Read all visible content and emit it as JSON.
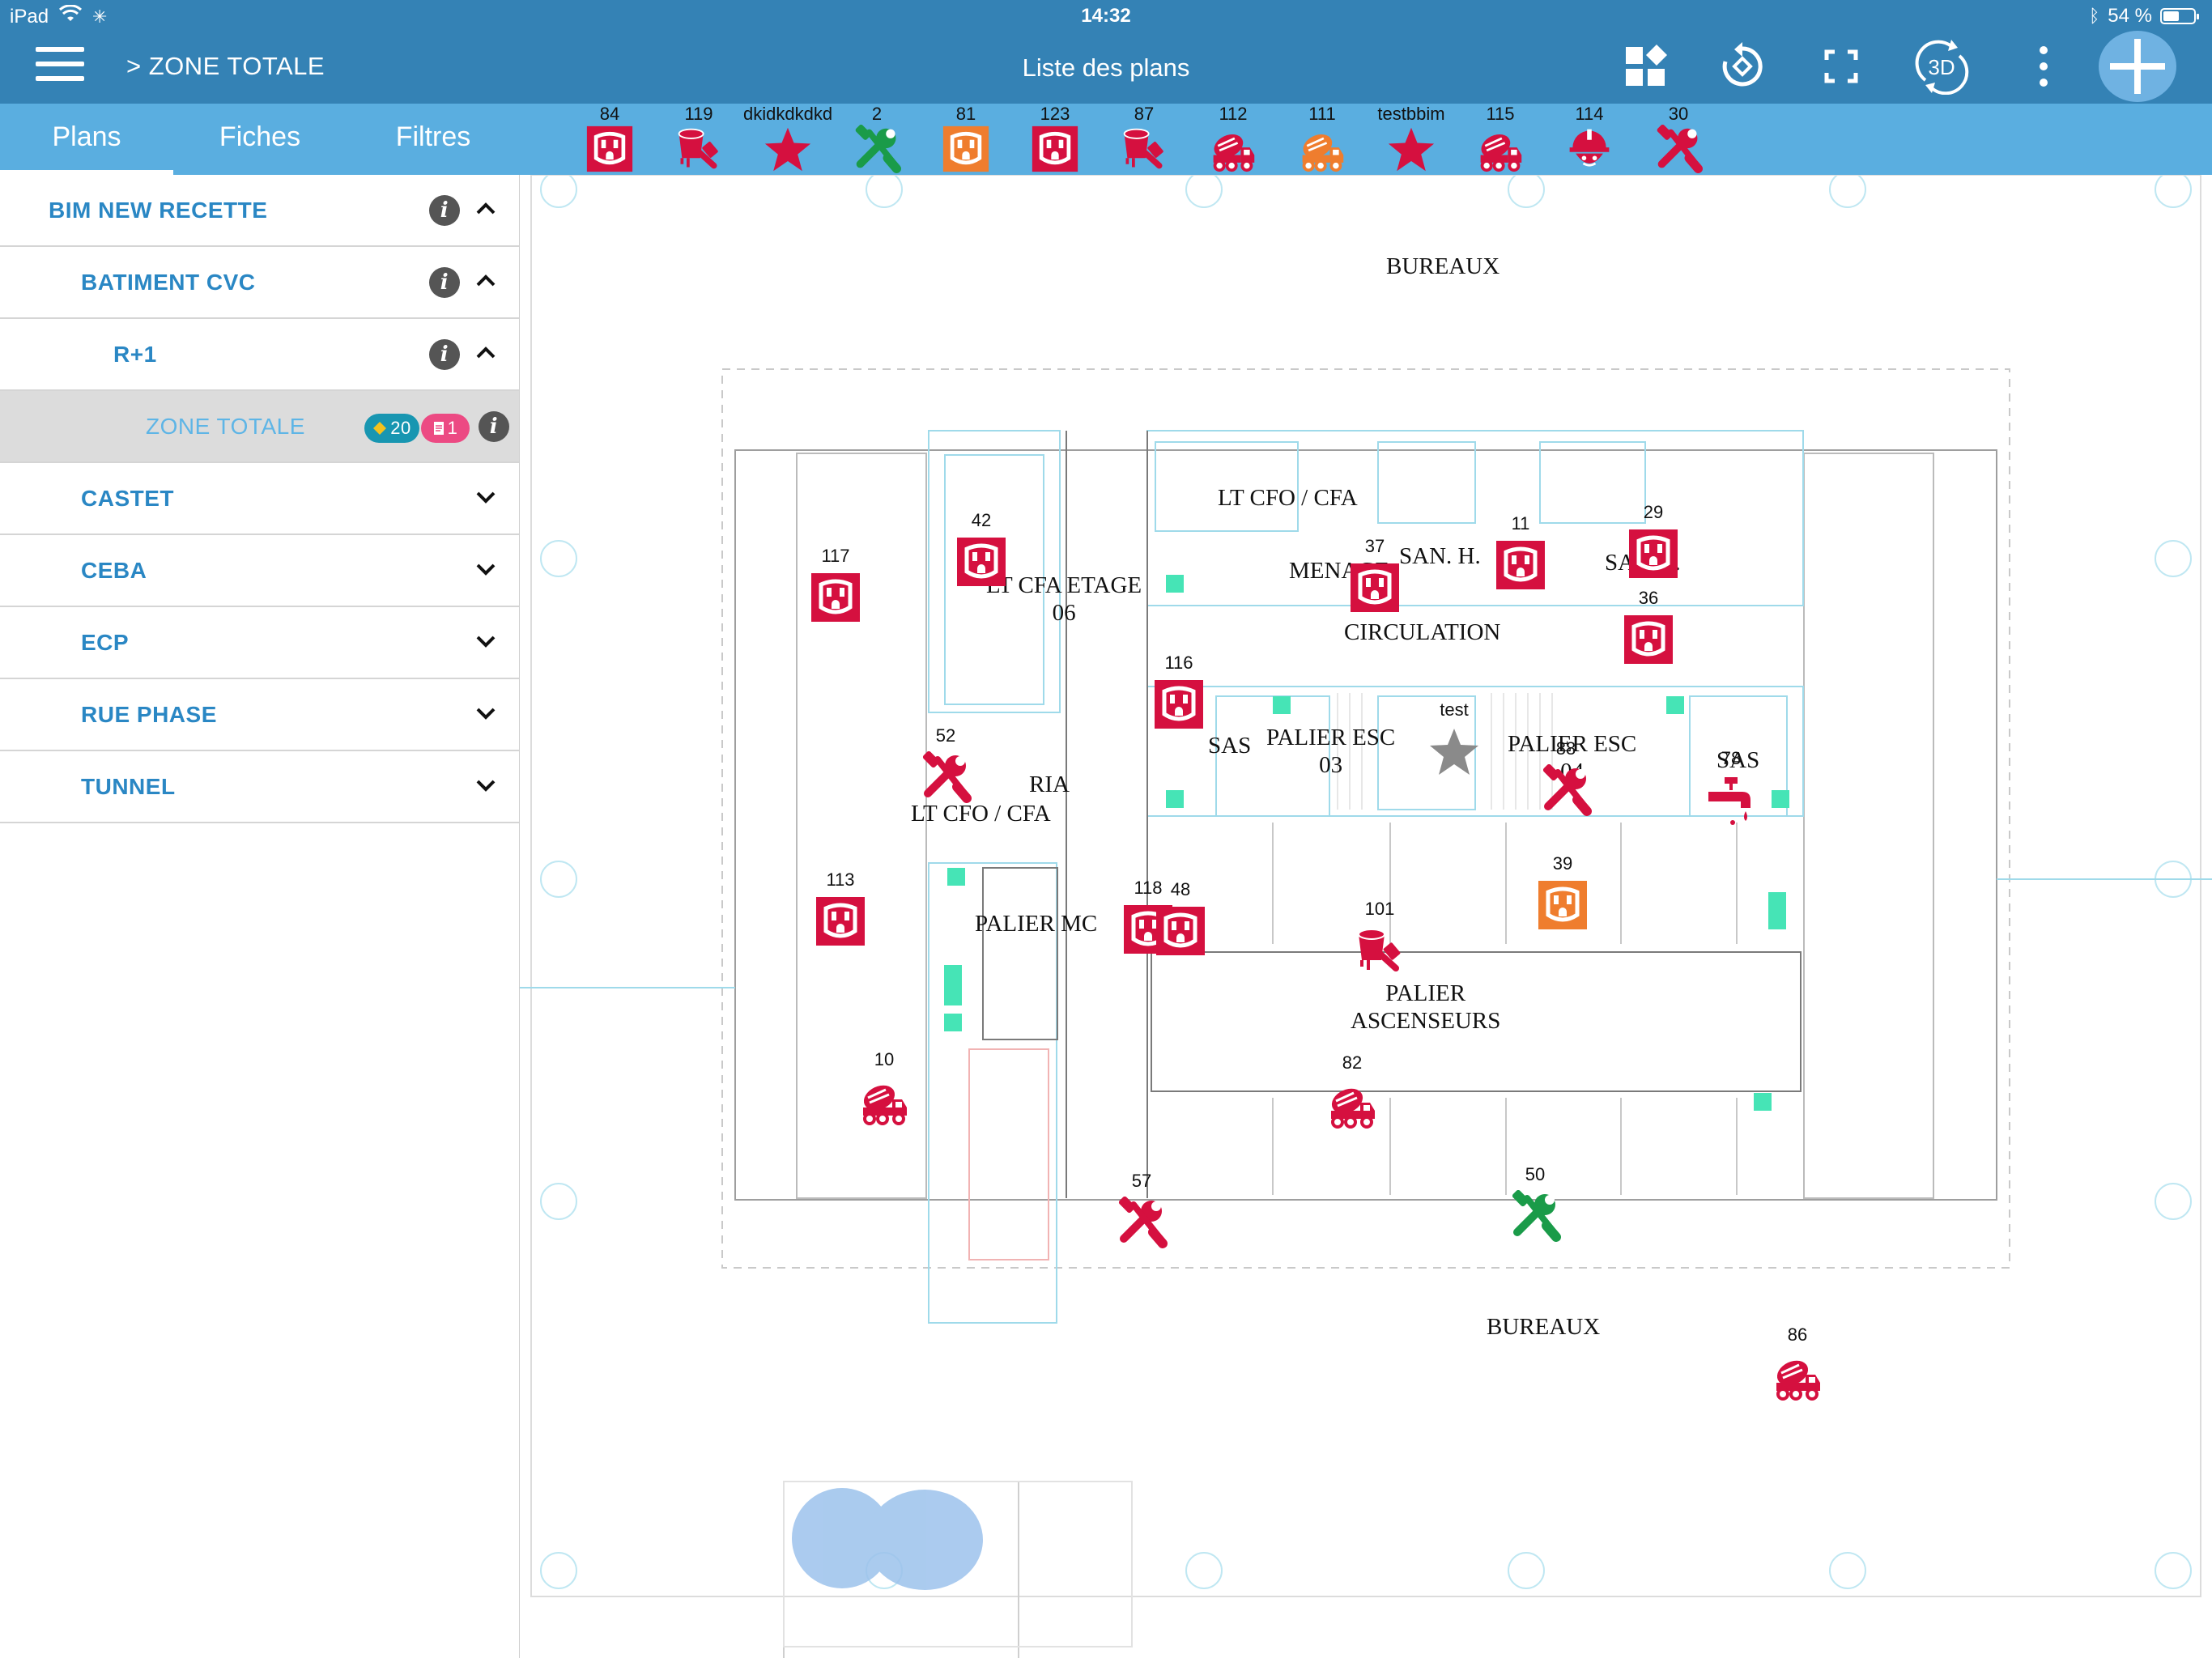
{
  "status": {
    "device": "iPad",
    "time": "14:32",
    "battery": "54 %",
    "battery_level": 0.54
  },
  "header": {
    "breadcrumb": "> ZONE TOTALE",
    "title": "Liste des plans",
    "toolbar_3d_label": "3D"
  },
  "colors": {
    "header": "#3482b5",
    "tabbar": "#5aaee0",
    "red": "#d5103f",
    "orange": "#ef7d2e",
    "green": "#1a9b49",
    "tree_text": "#2a87c4"
  },
  "tabs": [
    {
      "label": "Plans",
      "active": true
    },
    {
      "label": "Fiches",
      "active": false
    },
    {
      "label": "Filtres",
      "active": false
    }
  ],
  "tree": [
    {
      "label": "BIM NEW RECETTE",
      "level": 0,
      "info": true,
      "expanded": true
    },
    {
      "label": "BATIMENT CVC",
      "level": 1,
      "info": true,
      "expanded": true
    },
    {
      "label": "R+1",
      "level": 2,
      "info": true,
      "expanded": true
    },
    {
      "label": "ZONE TOTALE",
      "level": 3,
      "selected": true,
      "info": true,
      "badge_teal": "20",
      "badge_pink": "1"
    },
    {
      "label": "CASTET",
      "level": 1,
      "expanded": false
    },
    {
      "label": "CEBA",
      "level": 1,
      "expanded": false
    },
    {
      "label": "ECP",
      "level": 1,
      "expanded": false
    },
    {
      "label": "RUE PHASE",
      "level": 1,
      "expanded": false
    },
    {
      "label": "TUNNEL",
      "level": 1,
      "expanded": false
    }
  ],
  "pinbar": [
    {
      "num": "84",
      "icon": "outlet-icon",
      "color": "#d5103f"
    },
    {
      "num": "119",
      "icon": "paint-bucket-icon",
      "color": "#d5103f"
    },
    {
      "num": "dkidkdkdkd",
      "icon": "star-icon",
      "color": "#d5103f"
    },
    {
      "num": "2",
      "icon": "tools-icon",
      "color": "#1a9b49"
    },
    {
      "num": "81",
      "icon": "outlet-icon",
      "color": "#ef7d2e"
    },
    {
      "num": "123",
      "icon": "outlet-icon",
      "color": "#d5103f"
    },
    {
      "num": "87",
      "icon": "paint-bucket-icon",
      "color": "#d5103f"
    },
    {
      "num": "112",
      "icon": "concrete-truck-icon",
      "color": "#d5103f"
    },
    {
      "num": "111",
      "icon": "concrete-truck-icon",
      "color": "#ef7d2e"
    },
    {
      "num": "testbbim",
      "icon": "star-icon",
      "color": "#d5103f"
    },
    {
      "num": "115",
      "icon": "concrete-truck-icon",
      "color": "#d5103f"
    },
    {
      "num": "114",
      "icon": "worker-icon",
      "color": "#d5103f"
    },
    {
      "num": "30",
      "icon": "tools-icon",
      "color": "#d5103f"
    }
  ],
  "rooms": [
    {
      "name": "BUREAUX"
    },
    {
      "name": "LT CFO / CFA"
    },
    {
      "name": "MENAGE"
    },
    {
      "name": "SAN. H."
    },
    {
      "name": "SAN. F."
    },
    {
      "name": "LT CFA ETAGE\n06"
    },
    {
      "name": "CIRCULATION"
    },
    {
      "name": "SAS"
    },
    {
      "name": "PALIER ESC\n03"
    },
    {
      "name": "PALIER ESC\n04"
    },
    {
      "name": "SAS"
    },
    {
      "name": "RIA"
    },
    {
      "name": "LT CFO / CFA"
    },
    {
      "name": "PALIER MC"
    },
    {
      "name": "PALIER\nASCENSEURS"
    },
    {
      "name": "BUREAUX"
    }
  ],
  "pins": [
    {
      "num": "117",
      "icon": "outlet-icon",
      "color": "#d5103f"
    },
    {
      "num": "42",
      "icon": "outlet-icon",
      "color": "#d5103f"
    },
    {
      "num": "37",
      "icon": "outlet-icon",
      "color": "#d5103f"
    },
    {
      "num": "11",
      "icon": "outlet-icon",
      "color": "#d5103f"
    },
    {
      "num": "29",
      "icon": "outlet-icon",
      "color": "#d5103f"
    },
    {
      "num": "36",
      "icon": "outlet-icon",
      "color": "#d5103f"
    },
    {
      "num": "116",
      "icon": "outlet-icon",
      "color": "#d5103f"
    },
    {
      "num": "test",
      "icon": "star-icon",
      "color": "#8a8a8a"
    },
    {
      "num": "52",
      "icon": "tools-icon",
      "color": "#d5103f"
    },
    {
      "num": "88",
      "icon": "tools-icon",
      "color": "#d5103f"
    },
    {
      "num": "78",
      "icon": "faucet-icon",
      "color": "#d5103f"
    },
    {
      "num": "113",
      "icon": "outlet-icon",
      "color": "#d5103f"
    },
    {
      "num": "118",
      "icon": "outlet-icon",
      "color": "#d5103f"
    },
    {
      "num": "48",
      "icon": "outlet-icon",
      "color": "#d5103f"
    },
    {
      "num": "39",
      "icon": "outlet-icon",
      "color": "#ef7d2e"
    },
    {
      "num": "101",
      "icon": "paint-bucket-icon",
      "color": "#d5103f"
    },
    {
      "num": "10",
      "icon": "concrete-truck-icon",
      "color": "#d5103f"
    },
    {
      "num": "82",
      "icon": "concrete-truck-icon",
      "color": "#d5103f"
    },
    {
      "num": "57",
      "icon": "tools-icon",
      "color": "#d5103f"
    },
    {
      "num": "50",
      "icon": "tools-icon",
      "color": "#1a9b49"
    },
    {
      "num": "86",
      "icon": "concrete-truck-icon",
      "color": "#d5103f"
    }
  ]
}
